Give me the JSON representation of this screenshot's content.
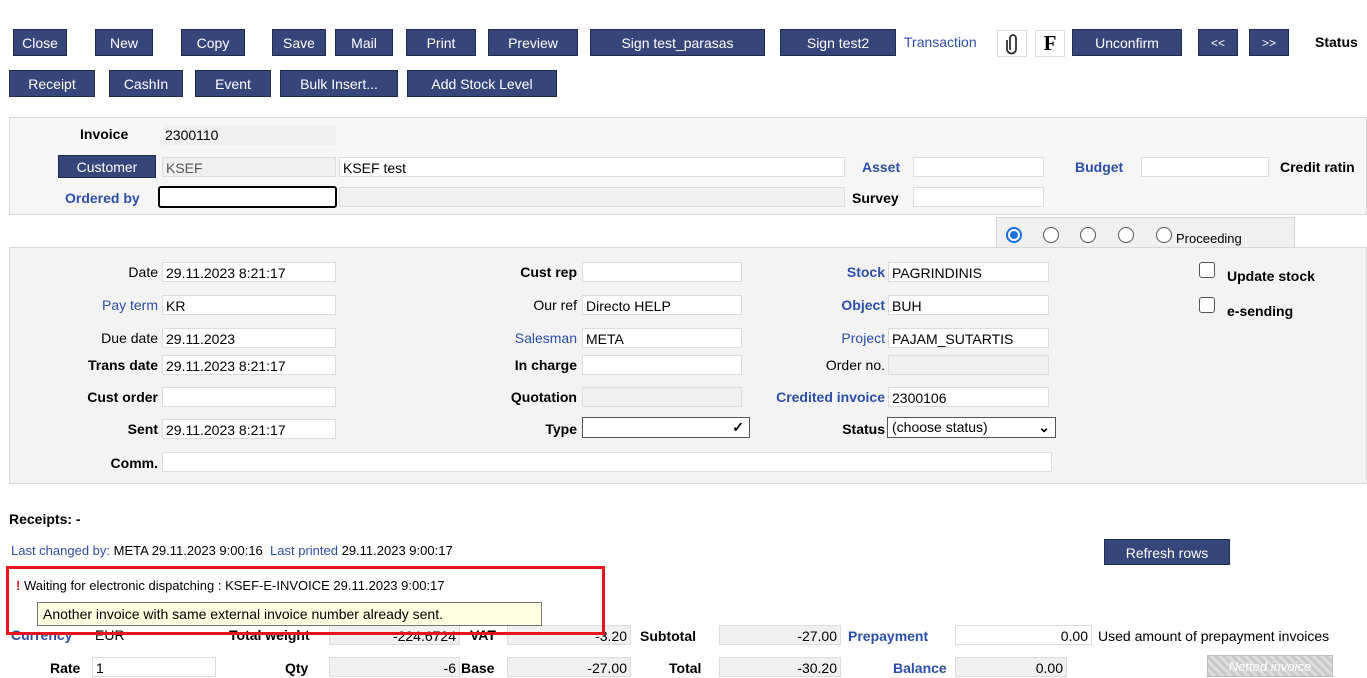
{
  "toolbar": {
    "row1": [
      "Close",
      "New",
      "Copy",
      "Save",
      "Mail",
      "Print",
      "Preview",
      "Sign test_parasas",
      "Sign test2"
    ],
    "transaction": "Transaction",
    "f_label": "F",
    "unconfirm": "Unconfirm",
    "prev": "<<",
    "next": ">>",
    "status": "Status",
    "row2": [
      "Receipt",
      "CashIn",
      "Event",
      "Bulk Insert...",
      "Add Stock Level"
    ]
  },
  "header": {
    "invoice_label": "Invoice",
    "invoice_value": "2300110",
    "customer_button": "Customer",
    "customer_code": "KSEF",
    "customer_name": "KSEF test",
    "asset_label": "Asset",
    "budget_label": "Budget",
    "credit_label": "Credit ratin",
    "ordered_by_label": "Ordered by",
    "survey_label": "Survey"
  },
  "tabs": {
    "proceeding": "Proceeding"
  },
  "form": {
    "date_label": "Date",
    "date_value": "29.11.2023 8:21:17",
    "pay_term_label": "Pay term",
    "pay_term_value": "KR",
    "due_date_label": "Due date",
    "due_date_value": "29.11.2023",
    "trans_date_label": "Trans date",
    "trans_date_value": "29.11.2023 8:21:17",
    "cust_order_label": "Cust order",
    "sent_label": "Sent",
    "sent_value": "29.11.2023 8:21:17",
    "comm_label": "Comm.",
    "cust_rep_label": "Cust rep",
    "our_ref_label": "Our ref",
    "our_ref_value": "Directo HELP",
    "salesman_label": "Salesman",
    "salesman_value": "META",
    "in_charge_label": "In charge",
    "quotation_label": "Quotation",
    "type_label": "Type",
    "stock_label": "Stock",
    "stock_value": "PAGRINDINIS",
    "object_label": "Object",
    "object_value": "BUH",
    "project_label": "Project",
    "project_value": "PAJAM_SUTARTIS",
    "order_no_label": "Order no.",
    "credited_label": "Credited invoice",
    "credited_value": "2300106",
    "status_label": "Status",
    "status_value": "(choose status)",
    "update_stock": "Update stock",
    "e_sending": "e-sending"
  },
  "info": {
    "receipts": "Receipts: -",
    "last_changed_label": "Last changed by:",
    "last_changed_value": "META 29.11.2023 9:00:16",
    "last_printed_label": "Last printed",
    "last_printed_value": "29.11.2023 9:00:17",
    "refresh_rows": "Refresh rows",
    "warning_mark": "!",
    "waiting_text": "Waiting for electronic dispatching : KSEF-E-INVOICE 29.11.2023 9:00:17",
    "tooltip": "Another invoice with same external invoice number already sent.",
    "highlight_color": "#e8141b"
  },
  "totals": {
    "currency_label": "Currency",
    "currency_value": "EUR",
    "total_weight_label": "Total weight",
    "total_weight_value": "-224.6724",
    "vat_label": "VAT",
    "vat_value": "-3.20",
    "subtotal_label": "Subtotal",
    "subtotal_value": "-27.00",
    "prepayment_label": "Prepayment",
    "prepayment_value": "0.00",
    "used_prepayment": "Used amount of prepayment invoices",
    "rate_label": "Rate",
    "rate_value": "1",
    "qty_label": "Qty",
    "qty_value": "-6",
    "base_label": "Base",
    "base_value": "-27.00",
    "total_label": "Total",
    "total_value": "-30.20",
    "balance_label": "Balance",
    "balance_value": "0.00",
    "netted": "Netted invoice"
  }
}
